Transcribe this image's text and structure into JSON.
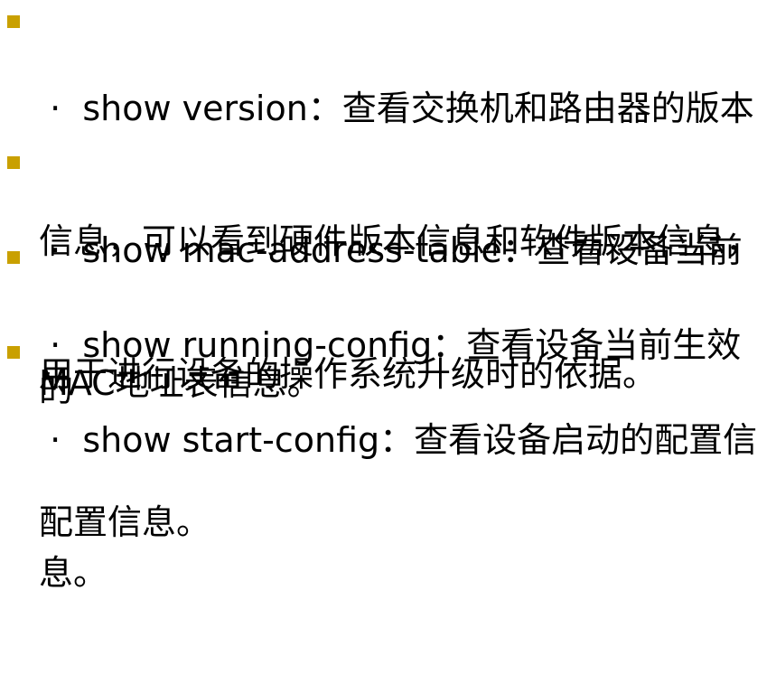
{
  "bullet_color": "#c9a000",
  "items": [
    {
      "lines": [
        " ·  show version：查看交换机和路由器的版本",
        "信息，可以看到硬件版本信息和软件版本信息，",
        "用于进行设备的操作系统升级时的依据。"
      ]
    },
    {
      "lines": [
        " ·  show mac-address-table：查看设备当前",
        "MAC地址表信息。"
      ]
    },
    {
      "lines": [
        " ·  show running-config：查看设备当前生效的",
        "配置信息。"
      ]
    },
    {
      "lines": [
        " ·  show start-config：查看设备启动的配置信",
        "息。"
      ]
    }
  ]
}
